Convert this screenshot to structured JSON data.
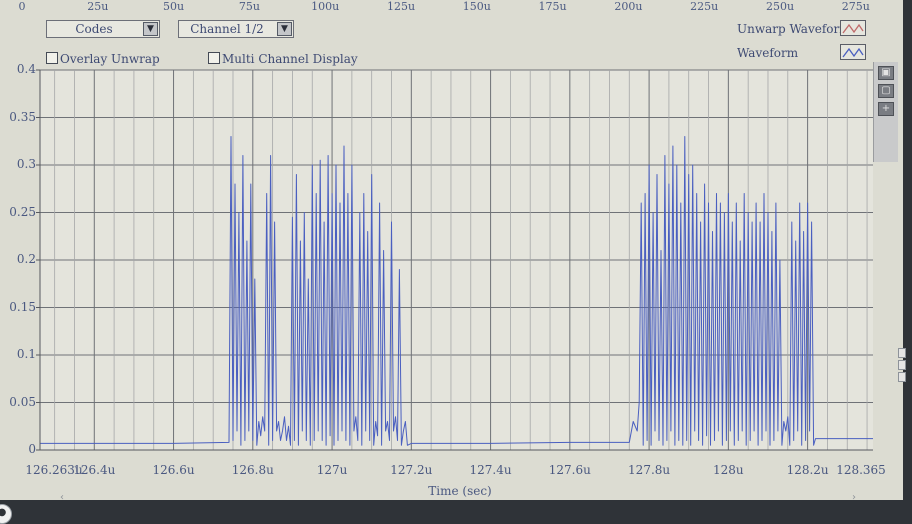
{
  "top_ruler": {
    "ticks": [
      "0",
      "25u",
      "50u",
      "75u",
      "100u",
      "125u",
      "150u",
      "175u",
      "200u",
      "225u",
      "250u",
      "275u"
    ]
  },
  "controls": {
    "view_select": "Codes",
    "channel_select": "Channel 1/2",
    "overlay_unwrap": {
      "label": "Overlay Unwrap",
      "checked": false
    },
    "multi_channel": {
      "label": "Multi Channel Display",
      "checked": false
    }
  },
  "legend": {
    "unwarp_label": "Unwarp Waveform",
    "waveform_label": "Waveform",
    "unwarp_color": "#c06a6a",
    "waveform_color": "#4a5fc0"
  },
  "side_tools": [
    "zoom-in-icon",
    "zoom-out-icon",
    "crosshair-icon"
  ],
  "chart_data": {
    "type": "line",
    "xlabel": "Time (sec)",
    "ylabel": "",
    "xlim": [
      126.263,
      128.365
    ],
    "ylim": [
      0,
      0.4
    ],
    "x_tick_labels": [
      "126.263u",
      "126.4u",
      "126.6u",
      "126.8u",
      "127u",
      "127.2u",
      "127.4u",
      "127.6u",
      "127.8u",
      "128u",
      "128.2u",
      "128.365"
    ],
    "x_tick_values": [
      126.263,
      126.4,
      126.6,
      126.8,
      127.0,
      127.2,
      127.4,
      127.6,
      127.8,
      128.0,
      128.2,
      128.365
    ],
    "y_tick_labels": [
      "0",
      "0.05",
      "0.1",
      "0.15",
      "0.2",
      "0.25",
      "0.3",
      "0.35",
      "0.4"
    ],
    "y_tick_values": [
      0,
      0.05,
      0.1,
      0.15,
      0.2,
      0.25,
      0.3,
      0.35,
      0.4
    ],
    "grid": true,
    "series": [
      {
        "color": "#4a5fc0",
        "x": [
          126.263,
          126.4,
          126.6,
          126.74,
          126.745,
          126.75,
          126.755,
          126.76,
          126.765,
          126.77,
          126.775,
          126.78,
          126.785,
          126.79,
          126.795,
          126.8,
          126.805,
          126.81,
          126.815,
          126.82,
          126.825,
          126.83,
          126.835,
          126.84,
          126.845,
          126.85,
          126.855,
          126.86,
          126.865,
          126.87,
          126.875,
          126.88,
          126.885,
          126.89,
          126.895,
          126.9,
          126.905,
          126.91,
          126.915,
          126.92,
          126.925,
          126.93,
          126.935,
          126.94,
          126.945,
          126.95,
          126.955,
          126.96,
          126.965,
          126.97,
          126.975,
          126.98,
          126.985,
          126.99,
          126.995,
          127.0,
          127.005,
          127.01,
          127.015,
          127.02,
          127.025,
          127.03,
          127.035,
          127.04,
          127.045,
          127.05,
          127.055,
          127.06,
          127.065,
          127.07,
          127.075,
          127.08,
          127.085,
          127.09,
          127.095,
          127.1,
          127.105,
          127.11,
          127.115,
          127.12,
          127.125,
          127.13,
          127.135,
          127.14,
          127.145,
          127.15,
          127.155,
          127.16,
          127.165,
          127.17,
          127.175,
          127.18,
          127.185,
          127.19,
          127.2,
          127.4,
          127.6,
          127.75,
          127.76,
          127.77,
          127.775,
          127.78,
          127.785,
          127.79,
          127.795,
          127.8,
          127.805,
          127.81,
          127.815,
          127.82,
          127.825,
          127.83,
          127.835,
          127.84,
          127.845,
          127.85,
          127.855,
          127.86,
          127.865,
          127.87,
          127.875,
          127.88,
          127.885,
          127.89,
          127.895,
          127.9,
          127.905,
          127.91,
          127.915,
          127.92,
          127.925,
          127.93,
          127.935,
          127.94,
          127.945,
          127.95,
          127.955,
          127.96,
          127.965,
          127.97,
          127.975,
          127.98,
          127.985,
          127.99,
          127.995,
          128.0,
          128.005,
          128.01,
          128.015,
          128.02,
          128.025,
          128.03,
          128.035,
          128.04,
          128.045,
          128.05,
          128.055,
          128.06,
          128.065,
          128.07,
          128.075,
          128.08,
          128.085,
          128.09,
          128.095,
          128.1,
          128.105,
          128.11,
          128.115,
          128.12,
          128.125,
          128.13,
          128.135,
          128.14,
          128.145,
          128.15,
          128.155,
          128.16,
          128.165,
          128.17,
          128.175,
          128.18,
          128.185,
          128.19,
          128.195,
          128.2,
          128.205,
          128.21,
          128.215,
          128.22,
          128.3,
          128.365
        ],
        "y": [
          0.007,
          0.007,
          0.007,
          0.008,
          0.33,
          0.01,
          0.28,
          0.02,
          0.25,
          0.005,
          0.31,
          0.01,
          0.22,
          0.02,
          0.28,
          0.01,
          0.18,
          0.005,
          0.03,
          0.015,
          0.035,
          0.02,
          0.27,
          0.005,
          0.31,
          0.01,
          0.24,
          0.02,
          0.03,
          0.01,
          0.02,
          0.035,
          0.01,
          0.025,
          0.005,
          0.245,
          0.01,
          0.29,
          0.005,
          0.22,
          0.02,
          0.25,
          0.01,
          0.18,
          0.005,
          0.3,
          0.01,
          0.27,
          0.02,
          0.305,
          0.01,
          0.24,
          0.005,
          0.31,
          0.015,
          0.27,
          0.005,
          0.3,
          0.01,
          0.26,
          0.02,
          0.32,
          0.01,
          0.27,
          0.005,
          0.3,
          0.02,
          0.035,
          0.01,
          0.25,
          0.005,
          0.27,
          0.02,
          0.23,
          0.01,
          0.29,
          0.005,
          0.03,
          0.015,
          0.26,
          0.005,
          0.21,
          0.02,
          0.03,
          0.01,
          0.24,
          0.02,
          0.035,
          0.01,
          0.19,
          0.005,
          0.02,
          0.03,
          0.005,
          0.007,
          0.007,
          0.008,
          0.008,
          0.03,
          0.02,
          0.05,
          0.26,
          0.005,
          0.27,
          0.01,
          0.3,
          0.005,
          0.25,
          0.02,
          0.29,
          0.01,
          0.21,
          0.005,
          0.31,
          0.01,
          0.28,
          0.02,
          0.32,
          0.005,
          0.3,
          0.01,
          0.26,
          0.005,
          0.33,
          0.01,
          0.29,
          0.005,
          0.3,
          0.02,
          0.27,
          0.01,
          0.24,
          0.005,
          0.28,
          0.015,
          0.26,
          0.005,
          0.23,
          0.01,
          0.27,
          0.02,
          0.26,
          0.005,
          0.25,
          0.01,
          0.27,
          0.02,
          0.24,
          0.005,
          0.26,
          0.01,
          0.22,
          0.02,
          0.27,
          0.005,
          0.25,
          0.01,
          0.24,
          0.02,
          0.26,
          0.005,
          0.24,
          0.01,
          0.27,
          0.02,
          0.25,
          0.005,
          0.23,
          0.01,
          0.26,
          0.02,
          0.2,
          0.005,
          0.03,
          0.02,
          0.035,
          0.005,
          0.24,
          0.01,
          0.22,
          0.02,
          0.26,
          0.005,
          0.23,
          0.01,
          0.26,
          0.02,
          0.24,
          0.005,
          0.012,
          0.012,
          0.012
        ]
      }
    ]
  }
}
